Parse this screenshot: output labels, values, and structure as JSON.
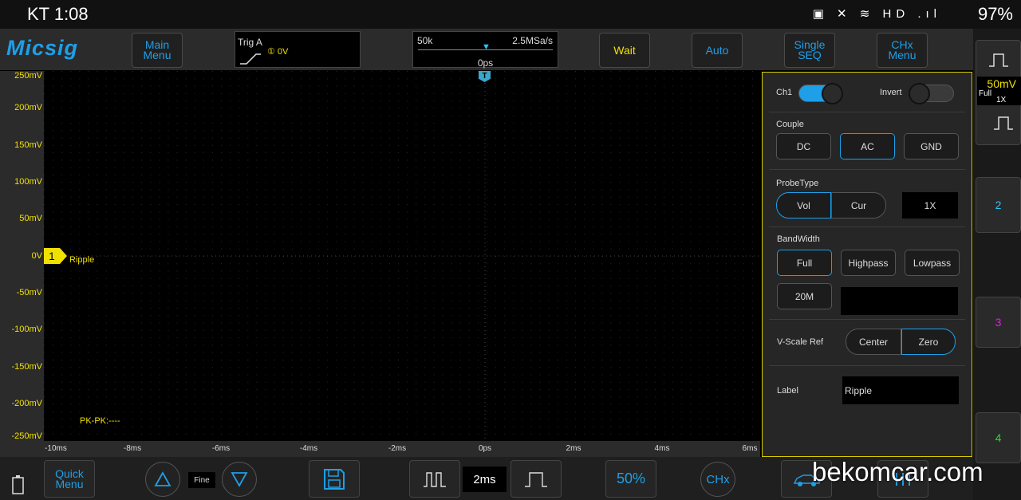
{
  "statusbar": {
    "time": "KT 1:08",
    "icons": "▣ ✕ ≋ HD .ıl",
    "battery": "97%"
  },
  "toolbar": {
    "logo": "Micsig",
    "main_menu": "Main Menu",
    "trig_label": "Trig A",
    "trig_source": "① 0V",
    "timebase_left": "50k",
    "timebase_right": "2.5MSa/s",
    "timebase_pos": "0ps",
    "wait": "Wait",
    "auto": "Auto",
    "single_seq": "Single SEQ",
    "chx_menu": "CHx Menu"
  },
  "screen": {
    "y_labels": [
      "250mV",
      "200mV",
      "150mV",
      "100mV",
      "50mV",
      "0V",
      "-50mV",
      "-100mV",
      "-150mV",
      "-200mV",
      "-250mV"
    ],
    "x_labels": [
      "-10ms",
      "-8ms",
      "-6ms",
      "-4ms",
      "-2ms",
      "0ps",
      "2ms",
      "4ms",
      "6ms"
    ],
    "ch1_marker": "1",
    "ch1_label": "Ripple",
    "trigger_marker": "T",
    "measurement": "PK-PK:----"
  },
  "panel": {
    "ch1": "Ch1",
    "invert": "Invert",
    "couple_title": "Couple",
    "couple_options": [
      "DC",
      "AC",
      "GND"
    ],
    "probe_title": "ProbeType",
    "probe_options": [
      "Vol",
      "Cur"
    ],
    "probe_factor": "1X",
    "bw_title": "BandWidth",
    "bw_options": [
      "Full",
      "Highpass",
      "Lowpass"
    ],
    "bw_20m": "20M",
    "vscale_title": "V-Scale Ref",
    "vscale_options": [
      "Center",
      "Zero"
    ],
    "label_title": "Label",
    "label_value": "Ripple"
  },
  "rstrip": {
    "scale": "50mV",
    "bw": "Full",
    "factor": "1X",
    "ch2": "2",
    "ch3": "3",
    "ch4": "4",
    "colors": {
      "ch1": "#f0e000",
      "ch2": "#26c6ff",
      "ch3": "#e020e0",
      "ch4": "#20e020"
    }
  },
  "bottombar": {
    "quick_menu": "Quick Menu",
    "fine": "Fine",
    "timebase": "2ms",
    "fifty": "50%",
    "chx": "CHx"
  },
  "watermark": "bekomcar.com"
}
